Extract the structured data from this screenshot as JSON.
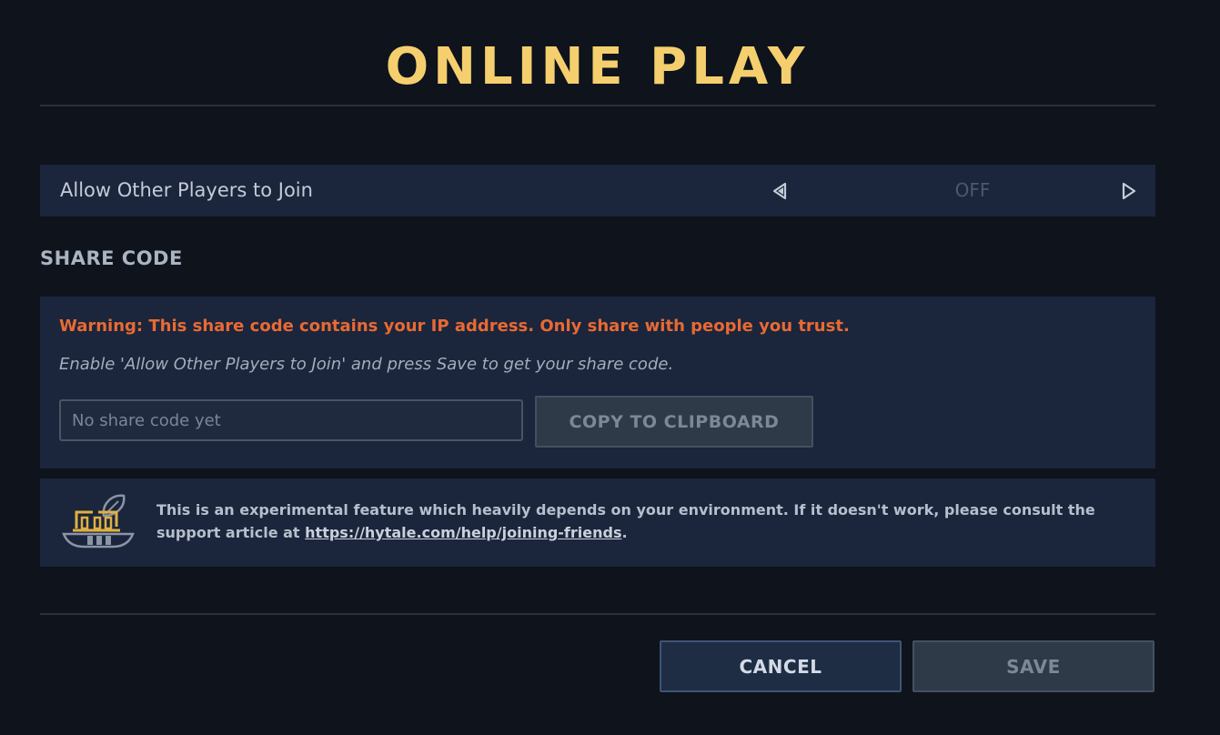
{
  "dialog": {
    "title": "ONLINE PLAY"
  },
  "allow_join": {
    "label": "Allow Other Players to Join",
    "value": "OFF",
    "prev_icon": "triangle-left-icon",
    "next_icon": "triangle-right-icon"
  },
  "share_code": {
    "heading": "SHARE CODE",
    "warning": "Warning: This share code contains your IP address. Only share with people you trust.",
    "hint": "Enable 'Allow Other Players to Join' and press Save to get your share code.",
    "input_value": "",
    "input_placeholder": "No share code yet",
    "copy_label": "COPY TO CLIPBOARD"
  },
  "info": {
    "icon": "experimental-feature-icon",
    "text_before": "This is an experimental feature which heavily depends on your environment. If it doesn't work, please consult the support article at ",
    "link": "https://hytale.com/help/joining-friends",
    "text_after": "."
  },
  "footer": {
    "cancel_label": "CANCEL",
    "save_label": "SAVE"
  },
  "colors": {
    "background": "#0e131c",
    "panel": "#1b253b",
    "title": "#f5cf6e",
    "warning": "#e86a33",
    "disabled_button": "#2f3a48"
  }
}
